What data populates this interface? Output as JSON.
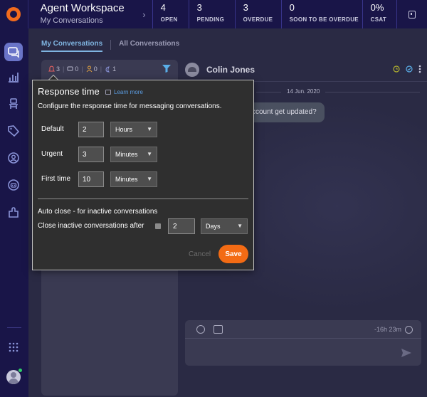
{
  "header": {
    "title": "Agent Workspace",
    "subtitle": "My Conversations",
    "stats": [
      {
        "value": "4",
        "label": "OPEN"
      },
      {
        "value": "3",
        "label": "PENDING"
      },
      {
        "value": "3",
        "label": "OVERDUE"
      },
      {
        "value": "0",
        "label": "SOON TO BE OVERDUE"
      },
      {
        "value": "0%",
        "label": "CSAT"
      }
    ]
  },
  "tabs": {
    "active": "My Conversations",
    "inactive": "All Conversations"
  },
  "list": {
    "counts": [
      "3",
      "0",
      "0",
      "1"
    ]
  },
  "chat": {
    "contact_name": "Colin Jones",
    "date": "14 Jun. 2020",
    "message_preview": "ccount get updated?",
    "composer_time": "-16h 23m"
  },
  "modal": {
    "title": "Response time",
    "learn_more": "Learn more",
    "description": "Configure the response time for messaging conversations.",
    "rows": [
      {
        "label": "Default",
        "value": "2",
        "unit": "Hours"
      },
      {
        "label": "Urgent",
        "value": "3",
        "unit": "Minutes"
      },
      {
        "label": "First time",
        "value": "10",
        "unit": "Minutes"
      }
    ],
    "auto_close_title": "Auto close - for inactive conversations",
    "auto_close_label": "Close inactive conversations after",
    "auto_close_value": "2",
    "auto_close_unit": "Days",
    "cancel_label": "Cancel",
    "save_label": "Save"
  },
  "colors": {
    "brand_orange": "#f26b1d",
    "header_bg": "#191548",
    "link_blue": "#5b9ce0",
    "active_tab": "#7fb4e0"
  }
}
